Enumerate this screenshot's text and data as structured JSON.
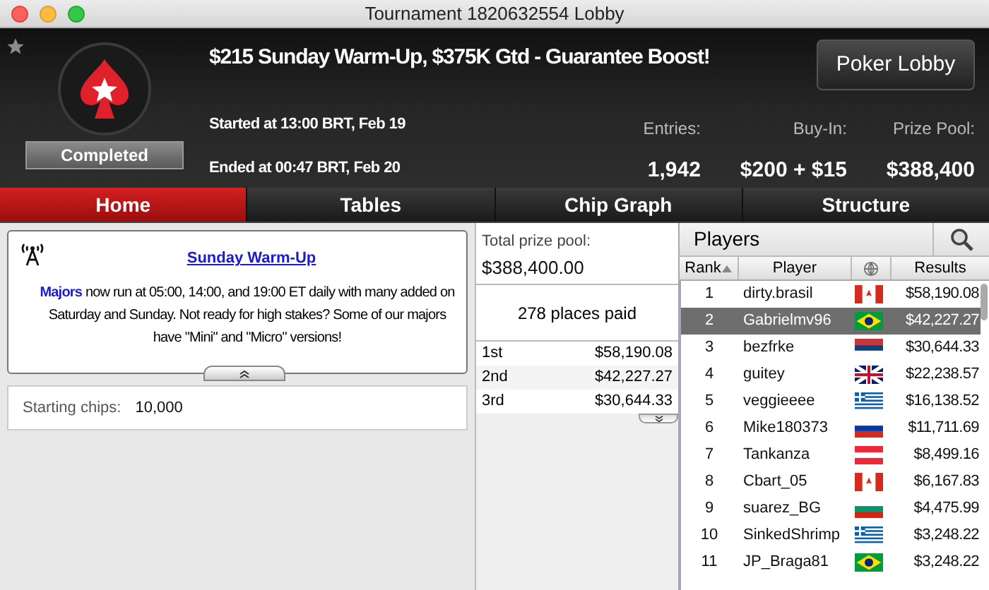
{
  "window": {
    "title": "Tournament 1820632554 Lobby"
  },
  "header": {
    "favorite": false,
    "status": "Completed",
    "title": "$215 Sunday Warm-Up, $375K Gtd - Guarantee Boost!",
    "lobby_button": "Poker Lobby",
    "started": "Started at 13:00 BRT, Feb 19",
    "ended": "Ended at 00:47 BRT, Feb 20",
    "stats": [
      {
        "label": "Entries:",
        "value": "1,942"
      },
      {
        "label": "Buy-In:",
        "value": "$200 + $15"
      },
      {
        "label": "Prize Pool:",
        "value": "$388,400"
      }
    ]
  },
  "tabs": [
    {
      "label": "Home",
      "selected": true
    },
    {
      "label": "Tables",
      "selected": false
    },
    {
      "label": "Chip Graph",
      "selected": false
    },
    {
      "label": "Structure",
      "selected": false
    }
  ],
  "news": {
    "title": "Sunday Warm-Up",
    "link": "Majors",
    "text": " now run at 05:00, 14:00, and 19:00 ET daily with many added on Saturday and Sunday. Not ready for high stakes? Some of our majors have \"Mini\" and \"Micro\" versions!"
  },
  "starting_chips": {
    "label": "Starting chips:",
    "value": "10,000"
  },
  "prizes": {
    "total_label": "Total prize pool:",
    "total": "$388,400.00",
    "places": "278 places paid",
    "rows": [
      {
        "place": "1st",
        "amount": "$58,190.08"
      },
      {
        "place": "2nd",
        "amount": "$42,227.27"
      },
      {
        "place": "3rd",
        "amount": "$30,644.33"
      }
    ]
  },
  "players": {
    "title": "Players",
    "columns": [
      "Rank",
      "Player",
      "Results"
    ],
    "rows": [
      {
        "rank": "1",
        "name": "dirty.brasil",
        "kind": "ca",
        "result": "$58,190.08",
        "selected": false
      },
      {
        "rank": "2",
        "name": "Gabrielmv96",
        "kind": "br",
        "result": "$42,227.27",
        "selected": true
      },
      {
        "rank": "3",
        "name": "bezfrke",
        "kind": "rs",
        "result": "$30,644.33",
        "selected": false
      },
      {
        "rank": "4",
        "name": "guitey",
        "kind": "gb",
        "result": "$22,238.57",
        "selected": false
      },
      {
        "rank": "5",
        "name": "veggieeee",
        "kind": "gr",
        "result": "$16,138.52",
        "selected": false
      },
      {
        "rank": "6",
        "name": "Mike180373",
        "kind": "ru",
        "result": "$11,711.69",
        "selected": false
      },
      {
        "rank": "7",
        "name": "Tankanza",
        "kind": "at",
        "result": "$8,499.16",
        "selected": false
      },
      {
        "rank": "8",
        "name": "Cbart_05",
        "kind": "ca",
        "result": "$6,167.83",
        "selected": false
      },
      {
        "rank": "9",
        "name": "suarez_BG",
        "kind": "bg",
        "result": "$4,475.99",
        "selected": false
      },
      {
        "rank": "10",
        "name": "SinkedShrimp",
        "kind": "gr",
        "result": "$3,248.22",
        "selected": false
      },
      {
        "rank": "11",
        "name": "JP_Braga81",
        "kind": "br",
        "result": "$3,248.22",
        "selected": false
      }
    ]
  }
}
